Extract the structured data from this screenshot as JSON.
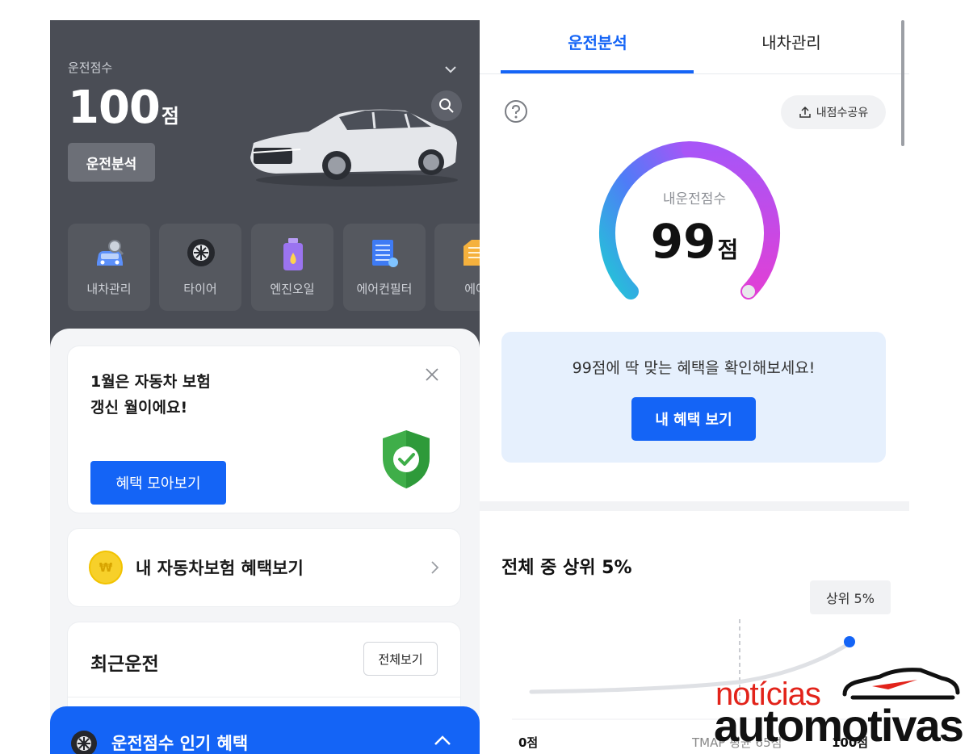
{
  "left": {
    "score_label": "운전점수",
    "score_value": "100",
    "score_unit": "점",
    "analysis_button": "운전분석",
    "tiles": [
      {
        "label": "내차관리",
        "icon": "car-search-icon"
      },
      {
        "label": "타이어",
        "icon": "tire-icon"
      },
      {
        "label": "엔진오일",
        "icon": "engine-oil-icon"
      },
      {
        "label": "에어컨필터",
        "icon": "aircon-filter-icon"
      },
      {
        "label": "에어",
        "icon": "air-filter-icon"
      }
    ],
    "insurance_card": {
      "title": "1월은 자동차 보험\n갱신 월이에요!",
      "button": "혜택 모아보기"
    },
    "benefit_card": {
      "coin_symbol": "₩",
      "text": "내 자동차보험 혜택보기"
    },
    "recent_card": {
      "title": "최근운전",
      "view_all": "전체보기"
    },
    "bottom_bar": {
      "text": "운전점수 인기 혜택"
    }
  },
  "right": {
    "tabs": [
      {
        "label": "운전분석",
        "active": true
      },
      {
        "label": "내차관리",
        "active": false
      }
    ],
    "share_button": "내점수공유",
    "gauge": {
      "label": "내운전점수",
      "score": "99",
      "unit": "점",
      "max": 100
    },
    "promo": {
      "text": "99점에 딱 맞는 혜택을 확인해보세요!",
      "button": "내 혜택 보기"
    },
    "rank": {
      "title": "전체 중 상위 5%",
      "tooltip": "상위 5%",
      "axis_start": "0점",
      "axis_mid": "TMAP 평균 65점",
      "axis_end": "100점"
    }
  },
  "watermark": {
    "line1": "notícias",
    "line2": "automotivas"
  },
  "colors": {
    "accent": "#1464f6",
    "dark_header": "#4a4d55",
    "promo_bg": "#e6f0fd",
    "watermark_red": "#e2231a"
  }
}
